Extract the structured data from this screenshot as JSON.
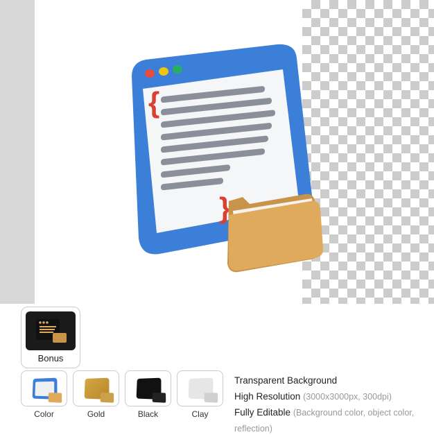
{
  "bonus": {
    "label": "Bonus"
  },
  "variants": [
    {
      "label": "Color"
    },
    {
      "label": "Gold"
    },
    {
      "label": "Black"
    },
    {
      "label": "Clay"
    }
  ],
  "features": {
    "transparent": "Transparent Background",
    "resolution": "High Resolution",
    "resolution_detail": "(3000x3000px, 300dpi)",
    "editable": "Fully Editable",
    "editable_detail": "(Background color, object color, reflection)"
  }
}
